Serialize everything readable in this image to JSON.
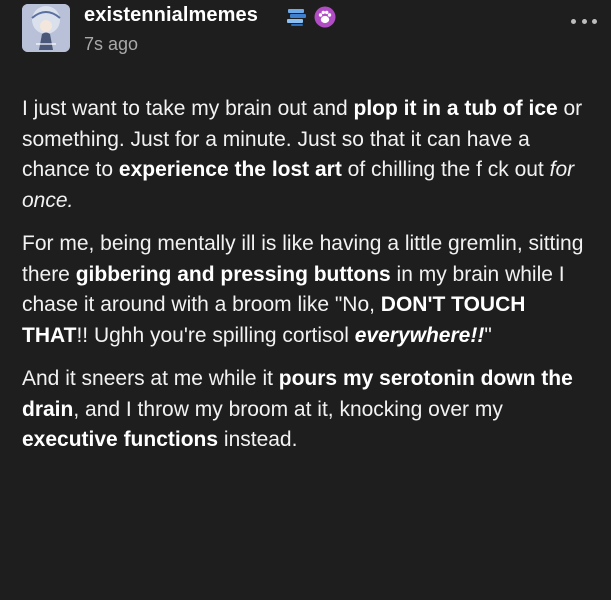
{
  "post": {
    "blog_name": "existennialmemes",
    "timestamp": "7s ago",
    "more_icon": "more-horizontal-icon",
    "badges": [
      "stacked-books-badge-icon",
      "purple-paw-badge-icon"
    ],
    "colors": {
      "background": "#1e1e1e",
      "text": "#f2f2f2",
      "muted": "#a9a9a9",
      "badge_blue": "#4a8ad6",
      "badge_purple": "#b04cc4"
    },
    "paragraphs": [
      {
        "runs": [
          {
            "style": "normal",
            "text": "I just want to take my brain out and "
          },
          {
            "style": "bold",
            "text": "plop it in a tub of ice"
          },
          {
            "style": "normal",
            "text": " or something. Just for a minute. Just so that it can have a chance to "
          },
          {
            "style": "bold",
            "text": "experience the lost art"
          },
          {
            "style": "normal",
            "text": " of chilling the f  ck out "
          },
          {
            "style": "italic",
            "text": "for once."
          }
        ]
      },
      {
        "runs": [
          {
            "style": "normal",
            "text": "For me, being mentally ill is like having a little gremlin, sitting there "
          },
          {
            "style": "bold",
            "text": "gibbering and pressing buttons"
          },
          {
            "style": "normal",
            "text": " in my brain while I chase it around with a broom like \"No, "
          },
          {
            "style": "bold",
            "text": "DON'T TOUCH THAT"
          },
          {
            "style": "normal",
            "text": "!! Ughh you're spilling cortisol "
          },
          {
            "style": "bold-italic",
            "text": "everywhere!!"
          },
          {
            "style": "normal",
            "text": "\""
          }
        ]
      },
      {
        "runs": [
          {
            "style": "normal",
            "text": "And it sneers at me while it "
          },
          {
            "style": "bold",
            "text": "pours my serotonin down the drain"
          },
          {
            "style": "normal",
            "text": ", and I throw my broom at it, knocking over my "
          },
          {
            "style": "bold",
            "text": "executive functions"
          },
          {
            "style": "normal",
            "text": " instead."
          }
        ]
      }
    ]
  }
}
